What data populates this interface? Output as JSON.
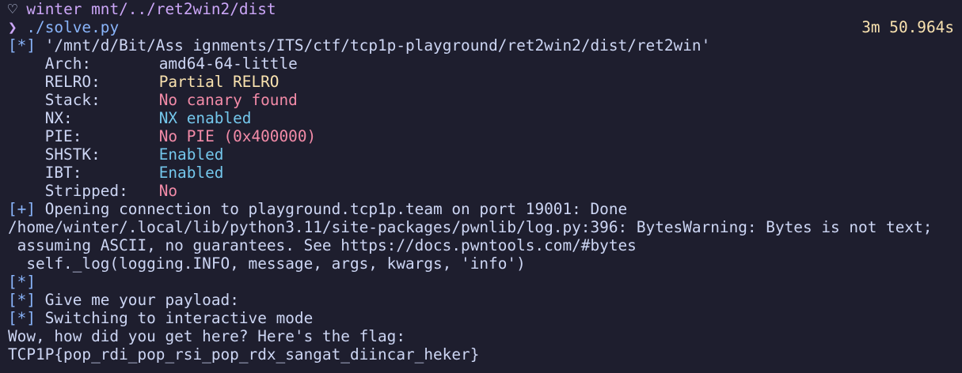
{
  "prompt": {
    "heart_glyph": "♡",
    "user": "winter",
    "path": "mnt/../ret2win2/dist",
    "arrow_glyph": "❯",
    "command": "./solve.py",
    "elapsed": "3m 50.964s"
  },
  "checksec": {
    "header_tag": "[*]",
    "header_path": "'/mnt/d/Bit/Ass ignments/ITS/ctf/tcp1p-playground/ret2win2/dist/ret2win'",
    "rows": [
      {
        "label": "Arch:",
        "value": "amd64-64-little",
        "color": "#cdd6f4"
      },
      {
        "label": "RELRO:",
        "value": "Partial RELRO",
        "color": "#f9e2af"
      },
      {
        "label": "Stack:",
        "value": "No canary found",
        "color": "#f38ba8"
      },
      {
        "label": "NX:",
        "value": "NX enabled",
        "color": "#74c7ec"
      },
      {
        "label": "PIE:",
        "value": "No PIE (0x400000)",
        "color": "#f38ba8"
      },
      {
        "label": "SHSTK:",
        "value": "Enabled",
        "color": "#74c7ec"
      },
      {
        "label": "IBT:",
        "value": "Enabled",
        "color": "#74c7ec"
      },
      {
        "label": "Stripped:",
        "value": "No",
        "color": "#f38ba8"
      }
    ]
  },
  "output": {
    "conn_tag": "[+]",
    "conn_text": "Opening connection to playground.tcp1p.team on port 19001: Done",
    "warn_line1": "/home/winter/.local/lib/python3.11/site-packages/pwnlib/log.py:396: BytesWarning: Bytes is not text;",
    "warn_line2": " assuming ASCII, no guarantees. See https://docs.pwntools.com/#bytes",
    "warn_line3": "  self._log(logging.INFO, message, args, kwargs, 'info')",
    "empty_tag": "[*]",
    "payload_tag": "[*]",
    "payload_text": "Give me your payload:",
    "interactive_tag": "[*]",
    "interactive_text": "Switching to interactive mode",
    "reply": "Wow, how did you get here? Here's the flag:",
    "flag": "TCP1P{pop_rdi_pop_rsi_pop_rdx_sangat_diincar_heker}"
  }
}
